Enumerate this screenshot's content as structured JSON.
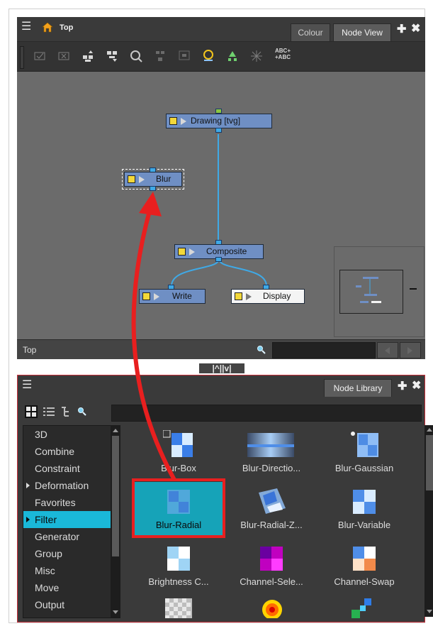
{
  "node_view": {
    "title": "Top",
    "tabs": [
      {
        "label": "Colour",
        "active": false
      },
      {
        "label": "Node View",
        "active": true
      }
    ],
    "toolbar_text_icon": [
      "ABC+",
      "+ABC"
    ],
    "breadcrumb": "Top",
    "nodes": [
      {
        "label": "Drawing  [tvg]",
        "style": "blue"
      },
      {
        "label": "Blur",
        "style": "blue",
        "selected": true
      },
      {
        "label": "Composite",
        "style": "blue"
      },
      {
        "label": "Write",
        "style": "blue"
      },
      {
        "label": "Display",
        "style": "white"
      }
    ],
    "splitter": "|^||v|"
  },
  "node_library": {
    "title": "Node Library",
    "categories": [
      {
        "label": "3D",
        "expandable": false
      },
      {
        "label": "Combine",
        "expandable": false
      },
      {
        "label": "Constraint",
        "expandable": false
      },
      {
        "label": "Deformation",
        "expandable": true
      },
      {
        "label": "Favorites",
        "expandable": false
      },
      {
        "label": "Filter",
        "expandable": true,
        "selected": true
      },
      {
        "label": "Generator",
        "expandable": false
      },
      {
        "label": "Group",
        "expandable": false
      },
      {
        "label": "Misc",
        "expandable": false
      },
      {
        "label": "Move",
        "expandable": false
      },
      {
        "label": "Output",
        "expandable": false
      }
    ],
    "items": [
      {
        "label": "Blur-Box",
        "icon": "blur-box-icon"
      },
      {
        "label": "Blur-Directio...",
        "icon": "blur-directional-icon"
      },
      {
        "label": "Blur-Gaussian",
        "icon": "blur-gaussian-icon"
      },
      {
        "label": "Blur-Radial",
        "icon": "blur-radial-icon",
        "selected": true
      },
      {
        "label": "Blur-Radial-Z...",
        "icon": "blur-radial-zoom-icon"
      },
      {
        "label": "Blur-Variable",
        "icon": "blur-variable-icon"
      },
      {
        "label": "Brightness C...",
        "icon": "brightness-contrast-icon"
      },
      {
        "label": "Channel-Sele...",
        "icon": "channel-selector-icon"
      },
      {
        "label": "Channel-Swap",
        "icon": "channel-swap-icon"
      }
    ],
    "colors": {
      "selection": "#1ab8d8",
      "highlight": "#e81f1f"
    }
  }
}
